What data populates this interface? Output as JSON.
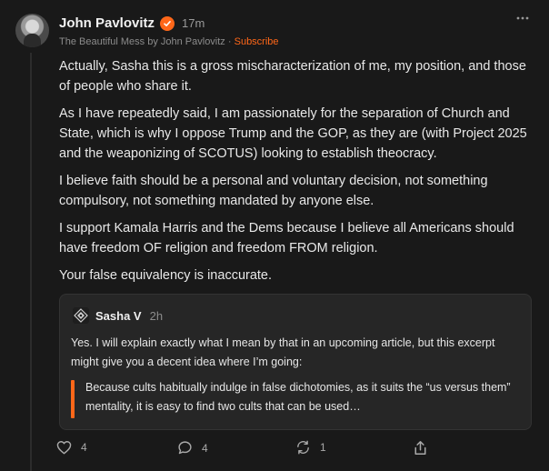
{
  "author": {
    "name": "John Pavlovitz",
    "timestamp": "17m",
    "publication": "The Beautiful Mess by John Pavlovitz",
    "separator": "·",
    "subscribe_label": "Subscribe"
  },
  "post": {
    "paragraphs": [
      "Actually, Sasha this is a gross mischaracterization of me, my position, and those of people who share it.",
      "As I have repeatedly said, I am passionately for the separation of Church and State, which is why I oppose Trump and the GOP, as they are (with Project 2025 and the weaponizing of SCOTUS) looking to establish theocracy.",
      "I believe faith should be a personal and voluntary decision, not something compulsory, not something mandated by anyone else.",
      "I support Kamala Harris and the Dems because I believe all Americans should have freedom OF religion and freedom FROM religion.",
      "Your false equivalency is inaccurate."
    ]
  },
  "quoted_note": {
    "author": "Sasha V",
    "timestamp": "2h",
    "text": "Yes.  I will explain exactly what I mean by that in an upcoming article, but this excerpt might give you a decent idea where I’m going:",
    "excerpt": "Because cults habitually indulge in false dichotomies, as it suits the “us versus them” mentality, it is easy to find two cults that can be used…"
  },
  "actions": {
    "likes": "4",
    "comments": "4",
    "restacks": "1"
  },
  "icons": {
    "verified": "verified-badge-icon",
    "more": "more-options-icon",
    "like": "heart-icon",
    "comment": "comment-bubble-icon",
    "restack": "restack-icon",
    "share": "share-icon"
  },
  "colors": {
    "accent": "#ff6719",
    "background": "#191919",
    "quote_background": "#262626"
  }
}
